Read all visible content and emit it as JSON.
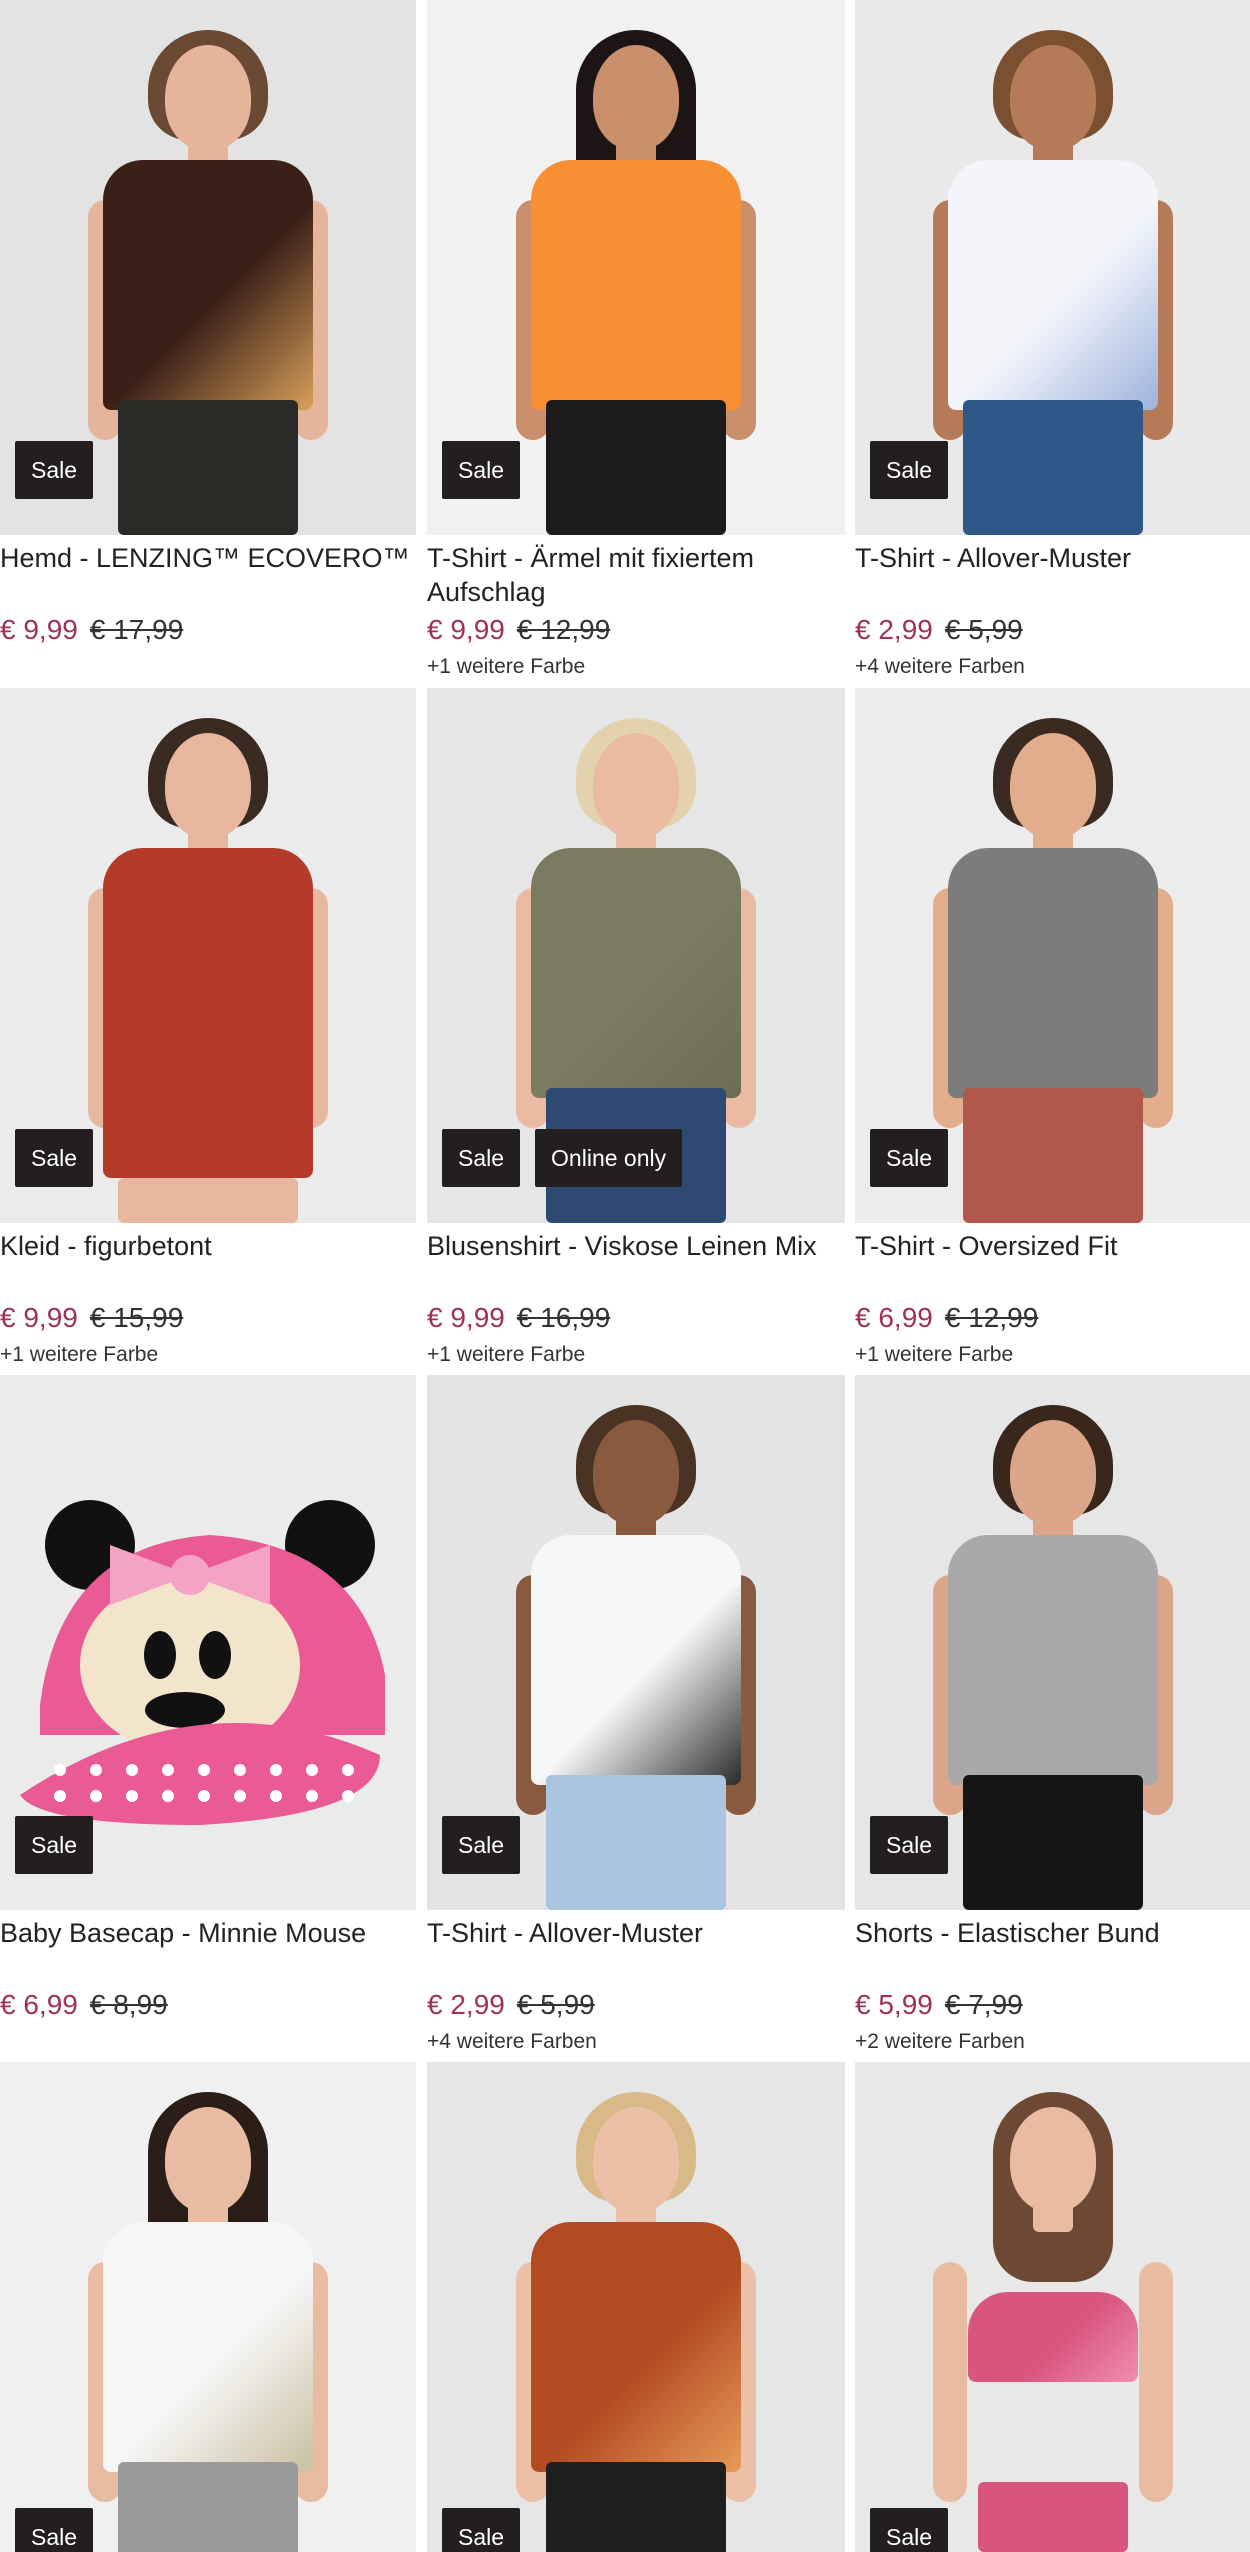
{
  "products": [
    {
      "title": "Hemd - LENZING™ ECOVERO™",
      "price": "€ 9,99",
      "old_price": "€ 17,99",
      "colors": "",
      "badges": [
        "Sale"
      ],
      "bg": "#e3e3e3",
      "top": "#3b2018",
      "top2": "#d9a05a",
      "bottom": "#2a2a26",
      "skin": "#e5b49a",
      "hair": "#6b4a33"
    },
    {
      "title": "T-Shirt - Ärmel mit fixiertem Aufschlag",
      "price": "€ 9,99",
      "old_price": "€ 12,99",
      "colors": "+1 weitere Farbe",
      "badges": [
        "Sale"
      ],
      "bg": "#f1f1f1",
      "top": "#f88f33",
      "top2": "#f88f33",
      "bottom": "#1c1c1c",
      "skin": "#c98e6a",
      "hair": "#1d1515"
    },
    {
      "title": "T-Shirt - Allover-Muster",
      "price": "€ 2,99",
      "old_price": "€ 5,99",
      "colors": "+4 weitere Farben",
      "badges": [
        "Sale"
      ],
      "bg": "#e9e9e9",
      "top": "#f3f5fb",
      "top2": "#9db3dc",
      "bottom": "#2f5787",
      "skin": "#b57a58",
      "hair": "#7a5030"
    },
    {
      "title": "Kleid - figurbetont",
      "price": "€ 9,99",
      "old_price": "€ 15,99",
      "colors": "+1 weitere Farbe",
      "badges": [
        "Sale"
      ],
      "bg": "#ebebeb",
      "top": "#b53a2a",
      "top2": "#b53a2a",
      "bottom": "#b53a2a",
      "skin": "#e6b79e",
      "hair": "#3b2a22"
    },
    {
      "title": "Blusenshirt - Viskose Leinen Mix",
      "price": "€ 9,99",
      "old_price": "€ 16,99",
      "colors": "+1 weitere Farbe",
      "badges": [
        "Sale",
        "Online only"
      ],
      "bg": "#e6e6e6",
      "top": "#7a7b60",
      "top2": "#6c6d54",
      "bottom": "#2e4a73",
      "skin": "#eabba2",
      "hair": "#e3d2ad"
    },
    {
      "title": "T-Shirt - Oversized Fit",
      "price": "€ 6,99",
      "old_price": "€ 12,99",
      "colors": "+1 weitere Farbe",
      "badges": [
        "Sale"
      ],
      "bg": "#ececec",
      "top": "#7c7c7a",
      "top2": "#7c7c7a",
      "bottom": "#b0584c",
      "skin": "#e1ad8d",
      "hair": "#3a2a22"
    },
    {
      "title": "Baby Basecap - Minnie Mouse",
      "price": "€ 6,99",
      "old_price": "€ 8,99",
      "colors": "",
      "badges": [
        "Sale"
      ],
      "bg": "#ebebeb",
      "top": "#ea5a94",
      "top2": "#f4a3c4",
      "bottom": "#1e1e1e",
      "skin": "#f3e4cc",
      "hair": "#111111"
    },
    {
      "title": "T-Shirt - Allover-Muster",
      "price": "€ 2,99",
      "old_price": "€ 5,99",
      "colors": "+4 weitere Farben",
      "badges": [
        "Sale"
      ],
      "bg": "#e4e4e4",
      "top": "#f7f7f7",
      "top2": "#2a2a2a",
      "bottom": "#a9c5df",
      "skin": "#8a5a3e",
      "hair": "#4b3323"
    },
    {
      "title": "Shorts - Elastischer Bund",
      "price": "€ 5,99",
      "old_price": "€ 7,99",
      "colors": "+2 weitere Farben",
      "badges": [
        "Sale"
      ],
      "bg": "#e6e6e6",
      "top": "#a9a9a9",
      "top2": "#a9a9a9",
      "bottom": "#151515",
      "skin": "#dba589",
      "hair": "#3a271b"
    },
    {
      "title": "",
      "price": "",
      "old_price": "",
      "colors": "",
      "badges": [
        "Sale"
      ],
      "bg": "#f0f0f0",
      "top": "#f6f6f6",
      "top2": "#c9bfa0",
      "bottom": "#9a9a9a",
      "skin": "#e8bca3",
      "hair": "#2b1e18"
    },
    {
      "title": "",
      "price": "",
      "old_price": "",
      "colors": "",
      "badges": [
        "Sale"
      ],
      "bg": "#e6e6e6",
      "top": "#b24a22",
      "top2": "#e79a5a",
      "bottom": "#1f1f1f",
      "skin": "#ecc0a6",
      "hair": "#d9b987"
    },
    {
      "title": "",
      "price": "",
      "old_price": "",
      "colors": "",
      "badges": [
        "Sale"
      ],
      "bg": "#e8e8e8",
      "top": "#d8557e",
      "top2": "#f08fb0",
      "bottom": "#d8557e",
      "skin": "#e9bca2",
      "hair": "#6d4934"
    }
  ]
}
